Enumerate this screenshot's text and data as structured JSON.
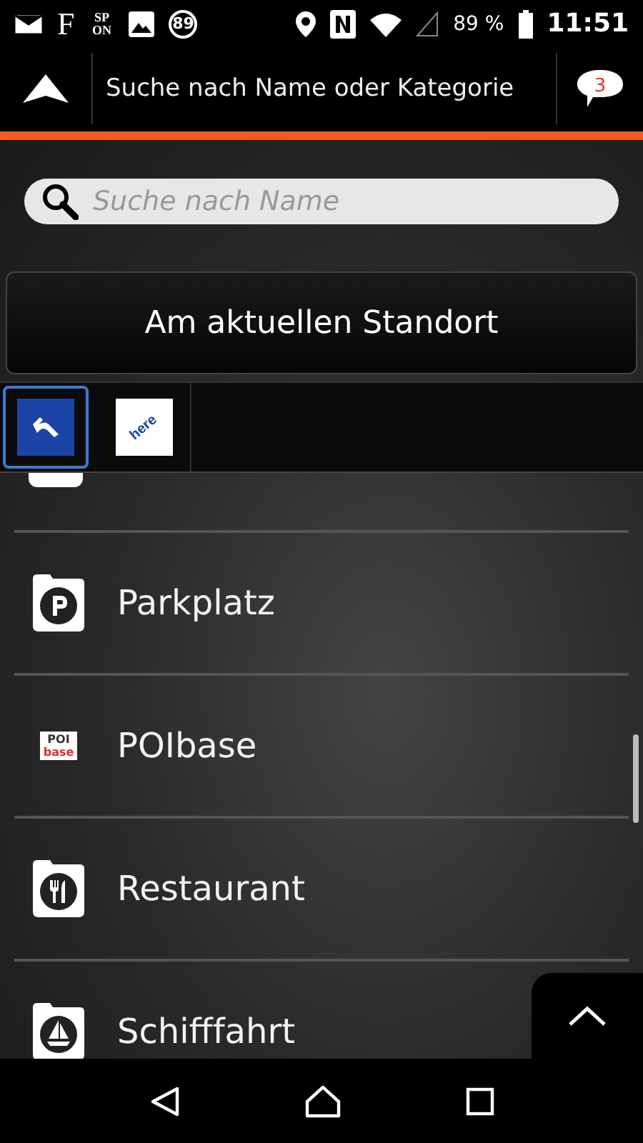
{
  "status_bar": {
    "left": [
      {
        "kind": "mail"
      },
      {
        "kind": "letter",
        "text": "F"
      },
      {
        "kind": "sp",
        "text": "SP ON"
      },
      {
        "kind": "image"
      },
      {
        "kind": "circle",
        "text": "89"
      }
    ],
    "battery": "89 %",
    "time": "11:51"
  },
  "app_bar": {
    "title": "Suche nach Name oder Kategorie",
    "badge": "3"
  },
  "search": {
    "placeholder": "Suche nach Name"
  },
  "location_button": "Am aktuellen Standort",
  "providers": [
    {
      "kind": "h",
      "selected": true
    },
    {
      "kind": "here",
      "text": "here",
      "selected": false
    }
  ],
  "items": [
    {
      "kind": "parking",
      "label": "Parkplatz"
    },
    {
      "kind": "poibase",
      "label": "POIbase",
      "logo": [
        "POI",
        "base"
      ]
    },
    {
      "kind": "restaurant",
      "label": "Restaurant"
    },
    {
      "kind": "ship",
      "label": "Schifffahrt"
    }
  ]
}
